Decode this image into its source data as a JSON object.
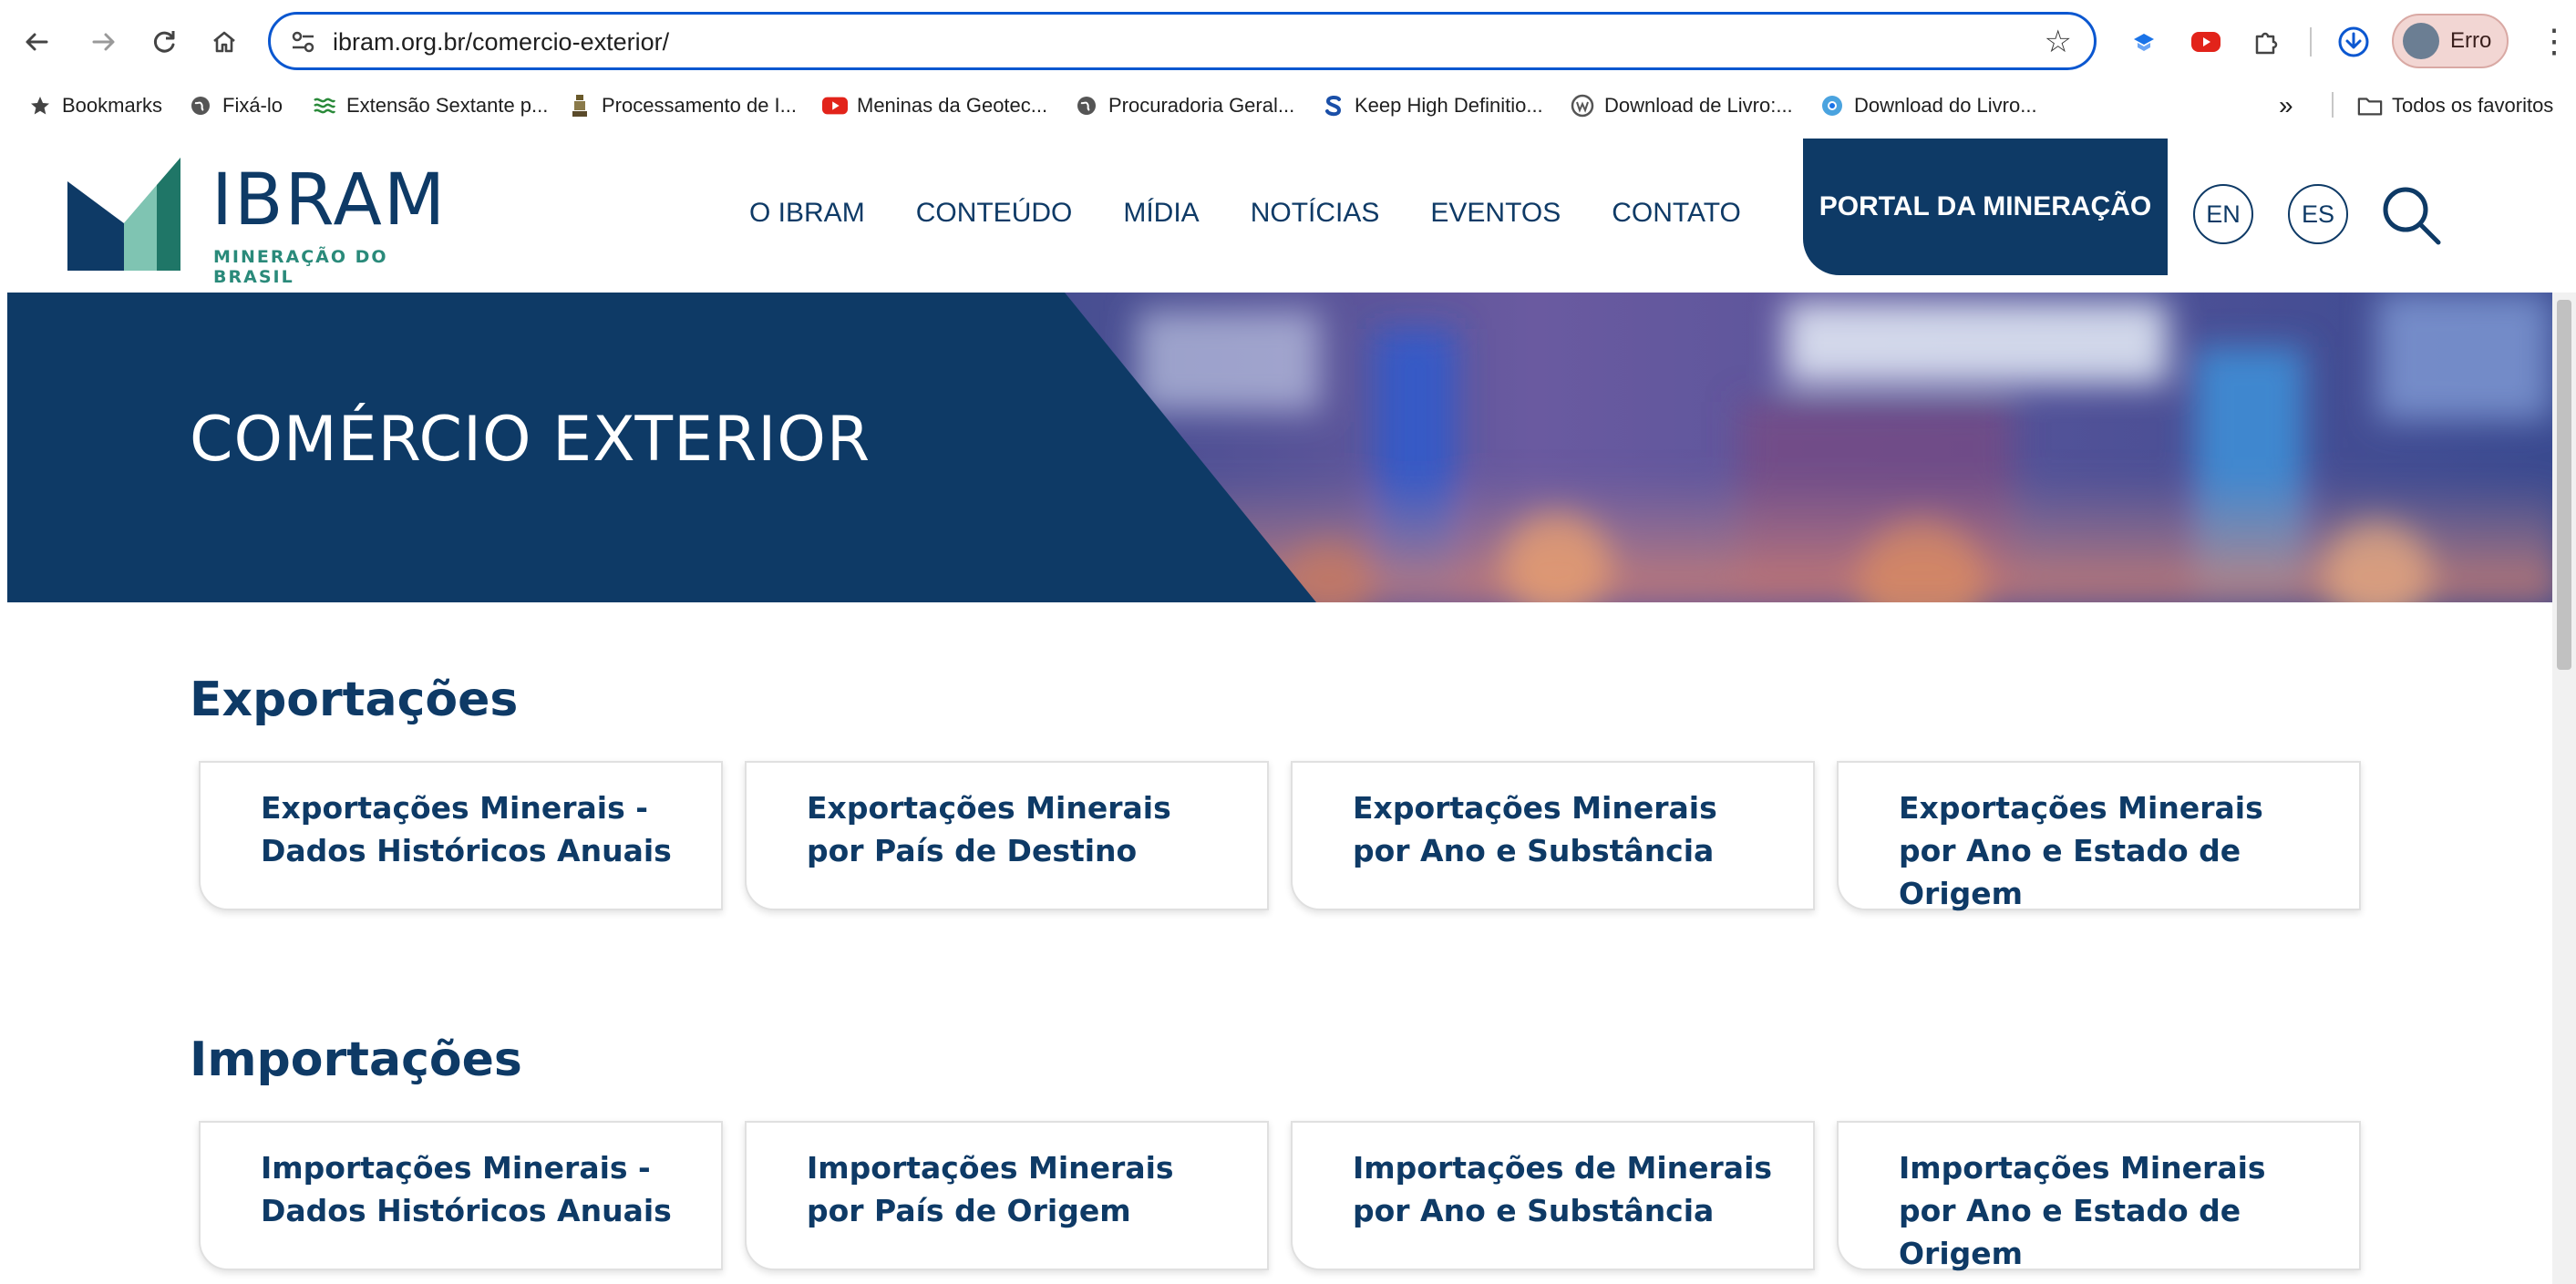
{
  "browser": {
    "url": "ibram.org.br/comercio-exterior/",
    "profile_label": "Erro",
    "bookmarks": [
      {
        "label": "Bookmarks",
        "icon": "star-icon"
      },
      {
        "label": "Fixá-lo",
        "icon": "globe-icon"
      },
      {
        "label": "Extensão Sextante p...",
        "icon": "sextante-icon"
      },
      {
        "label": "Processamento de I...",
        "icon": "figure-icon"
      },
      {
        "label": "Meninas da Geotec...",
        "icon": "youtube-icon"
      },
      {
        "label": "Procuradoria Geral...",
        "icon": "globe-icon"
      },
      {
        "label": "Keep High Definitio...",
        "icon": "s-icon"
      },
      {
        "label": "Download de Livro:...",
        "icon": "wordpress-icon"
      },
      {
        "label": "Download do Livro...",
        "icon": "chrome-icon"
      }
    ],
    "overflow_label": "»",
    "all_bookmarks_label": "Todos os favoritos"
  },
  "site": {
    "logo_word": "IBRAM",
    "logo_sub": "MINERAÇÃO DO BRASIL",
    "nav": [
      "O IBRAM",
      "CONTEÚDO",
      "MÍDIA",
      "NOTÍCIAS",
      "EVENTOS",
      "CONTATO"
    ],
    "portal_label": "PORTAL DA MINERAÇÃO",
    "lang_en": "EN",
    "lang_es": "ES"
  },
  "hero": {
    "title": "COMÉRCIO EXTERIOR"
  },
  "sections": [
    {
      "title": "Exportações",
      "cards": [
        "Exportações Minerais - Dados Históricos Anuais",
        "Exportações Minerais por País de Destino",
        "Exportações Minerais por Ano e Substância",
        "Exportações Minerais por Ano e Estado de Origem"
      ]
    },
    {
      "title": "Importações",
      "cards": [
        "Importações Minerais - Dados Históricos Anuais",
        "Importações Minerais por País de Origem",
        "Importações de Minerais por Ano e Substância",
        "Importações Minerais por Ano e Estado de Origem"
      ]
    }
  ],
  "colors": {
    "brand_navy": "#0e3a66",
    "brand_teal": "#2a8a7a",
    "browser_accent": "#0b57d0"
  }
}
